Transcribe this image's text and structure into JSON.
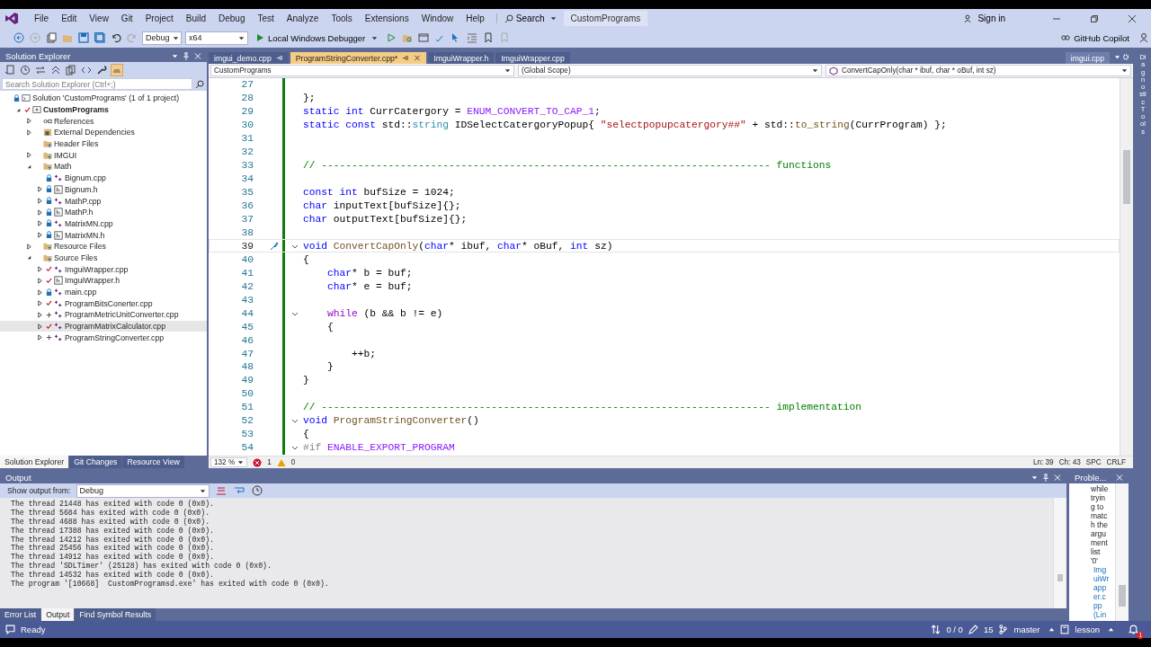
{
  "menu": [
    "File",
    "Edit",
    "View",
    "Git",
    "Project",
    "Build",
    "Debug",
    "Test",
    "Analyze",
    "Tools",
    "Extensions",
    "Window",
    "Help"
  ],
  "search": "Search",
  "solution_badge": "CustomPrograms",
  "sign_in": "Sign in",
  "copilot": "GitHub Copilot",
  "toolbar": {
    "config": "Debug",
    "platform": "x64",
    "run": "Local Windows Debugger"
  },
  "solution_explorer": {
    "title": "Solution Explorer",
    "search_placeholder": "Search Solution Explorer (Ctrl+;)",
    "tree": [
      {
        "label": "Solution 'CustomPrograms' (1 of 1 project)",
        "kind": "solution",
        "locked": true,
        "modified": false,
        "added": false,
        "selected": false,
        "children": [
          {
            "label": "CustomPrograms",
            "kind": "project",
            "locked": false,
            "modified": true,
            "added": false,
            "expanded": true,
            "selected": false,
            "children": [
              {
                "label": "References",
                "kind": "references",
                "expanded": false,
                "selected": false
              },
              {
                "label": "External Dependencies",
                "kind": "deps",
                "expanded": false,
                "selected": false
              },
              {
                "label": "Header Files",
                "kind": "filter",
                "selected": false
              },
              {
                "label": "IMGUI",
                "kind": "filter",
                "expanded": false,
                "selected": false
              },
              {
                "label": "Math",
                "kind": "filter",
                "expanded": true,
                "selected": false,
                "children": [
                  {
                    "label": "Bignum.cpp",
                    "kind": "cpp",
                    "locked": true,
                    "modified": false,
                    "added": false,
                    "selected": false
                  },
                  {
                    "label": "Bignum.h",
                    "kind": "h",
                    "locked": true,
                    "modified": false,
                    "added": false,
                    "expanded": false,
                    "selected": false
                  },
                  {
                    "label": "MathP.cpp",
                    "kind": "cpp",
                    "locked": true,
                    "modified": false,
                    "added": false,
                    "expanded": false,
                    "selected": false
                  },
                  {
                    "label": "MathP.h",
                    "kind": "h",
                    "locked": true,
                    "modified": false,
                    "added": false,
                    "expanded": false,
                    "selected": false
                  },
                  {
                    "label": "MatrixMN.cpp",
                    "kind": "cpp",
                    "locked": true,
                    "modified": false,
                    "added": false,
                    "expanded": false,
                    "selected": false
                  },
                  {
                    "label": "MatrixMN.h",
                    "kind": "h",
                    "locked": true,
                    "modified": false,
                    "added": false,
                    "expanded": false,
                    "selected": false
                  }
                ]
              },
              {
                "label": "Resource Files",
                "kind": "filter",
                "expanded": false,
                "selected": false
              },
              {
                "label": "Source Files",
                "kind": "filter",
                "expanded": true,
                "selected": false,
                "children": [
                  {
                    "label": "ImguiWrapper.cpp",
                    "kind": "cpp",
                    "locked": false,
                    "modified": true,
                    "added": false,
                    "expanded": false,
                    "selected": false
                  },
                  {
                    "label": "ImguiWrapper.h",
                    "kind": "h",
                    "locked": false,
                    "modified": true,
                    "added": false,
                    "expanded": false,
                    "selected": false
                  },
                  {
                    "label": "main.cpp",
                    "kind": "cpp",
                    "locked": true,
                    "modified": false,
                    "added": false,
                    "expanded": false,
                    "selected": false
                  },
                  {
                    "label": "ProgramBitsConerter.cpp",
                    "kind": "cpp",
                    "locked": false,
                    "modified": true,
                    "added": false,
                    "expanded": false,
                    "selected": false
                  },
                  {
                    "label": "ProgramMetricUnitConverter.cpp",
                    "kind": "cpp",
                    "locked": false,
                    "modified": false,
                    "added": true,
                    "expanded": false,
                    "selected": false
                  },
                  {
                    "label": "ProgramMatrixCalculator.cpp",
                    "kind": "cpp",
                    "locked": false,
                    "modified": true,
                    "added": false,
                    "expanded": false,
                    "selected": true
                  },
                  {
                    "label": "ProgramStringConverter.cpp",
                    "kind": "cpp",
                    "locked": false,
                    "modified": false,
                    "added": true,
                    "expanded": false,
                    "selected": false
                  }
                ]
              }
            ]
          }
        ]
      }
    ],
    "tabs": [
      {
        "label": "Solution Explorer",
        "selected": true
      },
      {
        "label": "Git Changes",
        "selected": false
      },
      {
        "label": "Resource View",
        "selected": false
      }
    ]
  },
  "editor": {
    "tabs": [
      {
        "label": "imgui_demo.cpp",
        "selected": false,
        "pinned": true
      },
      {
        "label": "ProgramStringConverter.cpp*",
        "selected": true,
        "pinned": true
      },
      {
        "label": "ImguiWrapper.h",
        "selected": false,
        "pinned": false
      },
      {
        "label": "ImguiWrapper.cpp",
        "selected": false,
        "pinned": false
      }
    ],
    "right_tab": "imgui.cpp",
    "nav": {
      "project": "CustomPrograms",
      "scope": "(Global Scope)",
      "member": "ConvertCapOnly(char * ibuf, char * oBuf, int sz)"
    },
    "lines": [
      {
        "n": "27",
        "current": false,
        "fold": false
      },
      {
        "n": "28",
        "current": false,
        "fold": false,
        "segs": [
          {
            "t": "};",
            "kind": "plain"
          }
        ]
      },
      {
        "n": "29",
        "current": false,
        "fold": false,
        "segs": [
          {
            "t": "static int ",
            "kind": "kw"
          },
          {
            "t": "CurrCatergory = ",
            "kind": "plain"
          },
          {
            "t": "ENUM_CONVERT_TO_CAP_1",
            "kind": "macro"
          },
          {
            "t": ";",
            "kind": "plain"
          }
        ]
      },
      {
        "n": "30",
        "current": false,
        "fold": false,
        "segs": [
          {
            "t": "static const ",
            "kind": "kw"
          },
          {
            "t": "std::",
            "kind": "plain"
          },
          {
            "t": "string",
            "kind": "type"
          },
          {
            "t": " IDSelectCatergoryPopup{ ",
            "kind": "plain"
          },
          {
            "t": "\"selectpopupcatergory##\"",
            "kind": "str"
          },
          {
            "t": " + std::",
            "kind": "plain"
          },
          {
            "t": "to_string",
            "kind": "fn"
          },
          {
            "t": "(CurrProgram) };",
            "kind": "plain"
          }
        ]
      },
      {
        "n": "31",
        "current": false,
        "fold": false
      },
      {
        "n": "32",
        "current": false,
        "fold": false
      },
      {
        "n": "33",
        "current": false,
        "fold": false,
        "segs": [
          {
            "t": "// -------------------------------------------------------------------------- functions",
            "kind": "cm"
          }
        ]
      },
      {
        "n": "34",
        "current": false,
        "fold": false
      },
      {
        "n": "35",
        "current": false,
        "fold": false,
        "segs": [
          {
            "t": "const int ",
            "kind": "kw"
          },
          {
            "t": "bufSize = 1024;",
            "kind": "plain"
          }
        ]
      },
      {
        "n": "36",
        "current": false,
        "fold": false,
        "segs": [
          {
            "t": "char ",
            "kind": "kw"
          },
          {
            "t": "inputText[bufSize]{};",
            "kind": "plain"
          }
        ]
      },
      {
        "n": "37",
        "current": false,
        "fold": false,
        "segs": [
          {
            "t": "char ",
            "kind": "kw"
          },
          {
            "t": "outputText[bufSize]{};",
            "kind": "plain"
          }
        ]
      },
      {
        "n": "38",
        "current": false,
        "fold": false
      },
      {
        "n": "39",
        "current": true,
        "fold": true,
        "segs": [
          {
            "t": "void ",
            "kind": "kw"
          },
          {
            "t": "ConvertCapOnly",
            "kind": "fn"
          },
          {
            "t": "(",
            "kind": "plain"
          },
          {
            "t": "char",
            "kind": "kw"
          },
          {
            "t": "* ibuf, ",
            "kind": "plain"
          },
          {
            "t": "char",
            "kind": "kw"
          },
          {
            "t": "* oBuf, ",
            "kind": "plain"
          },
          {
            "t": "int ",
            "kind": "kw"
          },
          {
            "t": "sz)",
            "kind": "plain"
          }
        ]
      },
      {
        "n": "40",
        "current": false,
        "fold": false,
        "segs": [
          {
            "t": "{",
            "kind": "plain"
          }
        ]
      },
      {
        "n": "41",
        "current": false,
        "fold": false,
        "segs": [
          {
            "t": "    char",
            "kind": "kw"
          },
          {
            "t": "* b = buf;",
            "kind": "plain"
          }
        ]
      },
      {
        "n": "42",
        "current": false,
        "fold": false,
        "segs": [
          {
            "t": "    char",
            "kind": "kw"
          },
          {
            "t": "* e = buf;",
            "kind": "plain"
          }
        ]
      },
      {
        "n": "43",
        "current": false,
        "fold": false
      },
      {
        "n": "44",
        "current": false,
        "fold": true,
        "segs": [
          {
            "t": "    while",
            "kind": "ctl"
          },
          {
            "t": " (b && b != e)",
            "kind": "plain"
          }
        ]
      },
      {
        "n": "45",
        "current": false,
        "fold": false,
        "segs": [
          {
            "t": "    {",
            "kind": "plain"
          }
        ]
      },
      {
        "n": "46",
        "current": false,
        "fold": false
      },
      {
        "n": "47",
        "current": false,
        "fold": false,
        "segs": [
          {
            "t": "        ++b;",
            "kind": "plain"
          }
        ]
      },
      {
        "n": "48",
        "current": false,
        "fold": false,
        "segs": [
          {
            "t": "    }",
            "kind": "plain"
          }
        ]
      },
      {
        "n": "49",
        "current": false,
        "fold": false,
        "segs": [
          {
            "t": "}",
            "kind": "plain"
          }
        ]
      },
      {
        "n": "50",
        "current": false,
        "fold": false
      },
      {
        "n": "51",
        "current": false,
        "fold": false,
        "segs": [
          {
            "t": "// -------------------------------------------------------------------------- implementation",
            "kind": "cm"
          }
        ]
      },
      {
        "n": "52",
        "current": false,
        "fold": true,
        "segs": [
          {
            "t": "void ",
            "kind": "kw"
          },
          {
            "t": "ProgramStringConverter",
            "kind": "fn"
          },
          {
            "t": "()",
            "kind": "plain"
          }
        ]
      },
      {
        "n": "53",
        "current": false,
        "fold": false,
        "segs": [
          {
            "t": "{",
            "kind": "plain"
          }
        ]
      },
      {
        "n": "54",
        "current": false,
        "fold": true,
        "segs": [
          {
            "t": "#if ",
            "kind": "pre"
          },
          {
            "t": "ENABLE_EXPORT_PROGRAM",
            "kind": "macro"
          }
        ]
      }
    ],
    "zoom": "132 %",
    "errors": "1",
    "warnings": "0",
    "line": "Ln: 39",
    "col": "Ch: 43",
    "spacing": "SPC",
    "eol": "CRLF"
  },
  "output": {
    "title": "Output",
    "show_from": "Show output from:",
    "source": "Debug",
    "lines": [
      "The thread 21448 has exited with code 0 (0x0).",
      "The thread 5684 has exited with code 0 (0x0).",
      "The thread 4688 has exited with code 0 (0x0).",
      "The thread 17388 has exited with code 0 (0x0).",
      "The thread 14212 has exited with code 0 (0x0).",
      "The thread 25456 has exited with code 0 (0x0).",
      "The thread 14912 has exited with code 0 (0x0).",
      "The thread 'SDLTimer' (25128) has exited with code 0 (0x0).",
      "The thread 14532 has exited with code 0 (0x0).",
      "The program '[10668]  CustomProgramsd.exe' has exited with code 0 (0x0)."
    ],
    "tabs": [
      {
        "label": "Error List",
        "selected": false
      },
      {
        "label": "Output",
        "selected": true
      },
      {
        "label": "Find Symbol Results",
        "selected": false
      }
    ]
  },
  "problems": {
    "title": "Proble...",
    "lines": [
      {
        "t": "while",
        "kind": "text"
      },
      {
        "t": "tryin",
        "kind": "text"
      },
      {
        "t": "g to",
        "kind": "text"
      },
      {
        "t": "matc",
        "kind": "text"
      },
      {
        "t": "h the",
        "kind": "text"
      },
      {
        "t": "argu",
        "kind": "text"
      },
      {
        "t": "ment",
        "kind": "text"
      },
      {
        "t": "list",
        "kind": "text"
      },
      {
        "t": "'0'",
        "kind": "text"
      },
      {
        "t": "Img",
        "kind": "link"
      },
      {
        "t": "uiWr",
        "kind": "link"
      },
      {
        "t": "app",
        "kind": "link"
      },
      {
        "t": "er.c",
        "kind": "link"
      },
      {
        "t": "pp",
        "kind": "link"
      },
      {
        "t": "(Lin",
        "kind": "link"
      }
    ]
  },
  "side_strip": "Diagnostic Tools",
  "status": {
    "text": "Ready",
    "sync": "0 / 0",
    "edits": "15",
    "branch": "master",
    "repo": "lesson",
    "notifications": "1"
  }
}
